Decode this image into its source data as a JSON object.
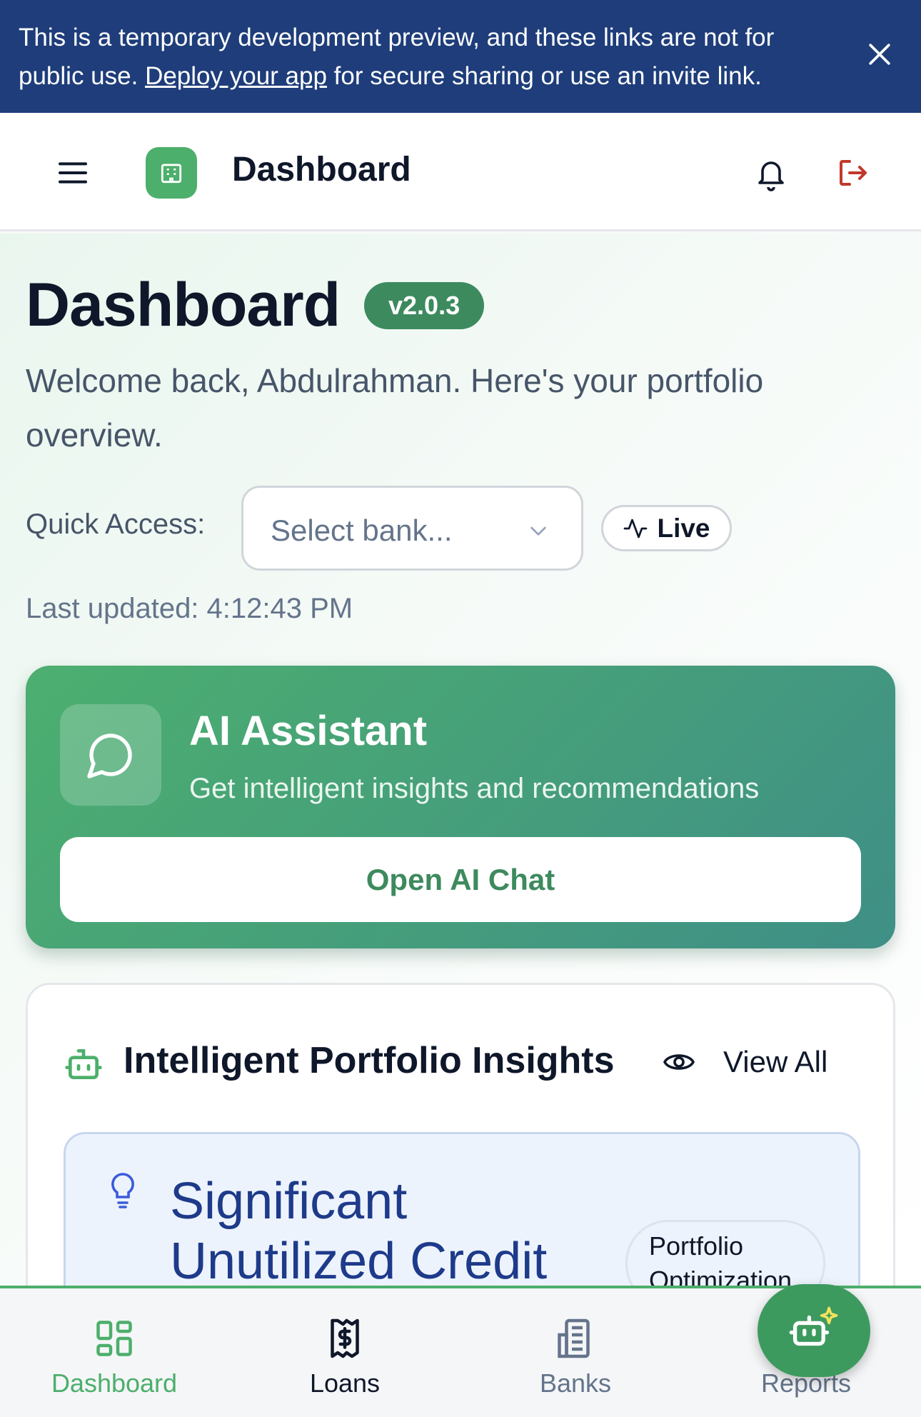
{
  "banner": {
    "text_before": "This is a temporary development preview, and these links are not for public use. ",
    "link": "Deploy your app",
    "text_after": " for secure sharing or use an invite link."
  },
  "header": {
    "title": "Dashboard"
  },
  "page": {
    "title": "Dashboard",
    "version": "v2.0.3",
    "welcome": "Welcome back, Abdulrahman. Here's your portfolio overview."
  },
  "quick_access": {
    "label": "Quick Access:",
    "placeholder": "Select bank...",
    "live_label": "Live",
    "last_updated": "Last updated: 4:12:43 PM"
  },
  "ai_assistant": {
    "title": "AI Assistant",
    "subtitle": "Get intelligent insights and recommendations",
    "button": "Open AI Chat"
  },
  "insights": {
    "title": "Intelligent Portfolio Insights",
    "view_all": "View All",
    "items": [
      {
        "title": "Significant Unutilized Credit",
        "tag": "Portfolio Optimization"
      }
    ]
  },
  "bottom_nav": {
    "items": [
      {
        "label": "Dashboard",
        "icon": "grid-icon",
        "active": true
      },
      {
        "label": "Loans",
        "icon": "receipt-dollar-icon",
        "active": false
      },
      {
        "label": "Banks",
        "icon": "building-icon",
        "active": false
      },
      {
        "label": "Reports",
        "icon": "chart-icon",
        "active": false
      }
    ]
  },
  "colors": {
    "brand_green": "#3d8a5e",
    "banner_blue": "#1e3d7a",
    "insight_blue": "#1e3a8a",
    "logout_red": "#c0392b"
  }
}
